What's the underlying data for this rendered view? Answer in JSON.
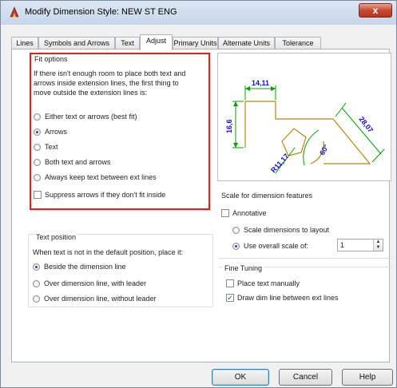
{
  "window": {
    "title": "Modify Dimension Style: NEW ST ENG",
    "close_label": "x"
  },
  "tabs": [
    {
      "label": "Lines",
      "active": false
    },
    {
      "label": "Symbols and Arrows",
      "active": false
    },
    {
      "label": "Text",
      "active": false
    },
    {
      "label": "Adjust",
      "active": true
    },
    {
      "label": "Primary Units",
      "active": false
    },
    {
      "label": "Alternate Units",
      "active": false
    },
    {
      "label": "Tolerance",
      "active": false
    }
  ],
  "fit_options": {
    "title": "Fit options",
    "description": [
      "If there isn't enough room to place both text and",
      "arrows inside extension lines, the first thing to",
      "move outside the extension lines is:"
    ],
    "options": [
      {
        "label": "Either text or arrows (best fit)",
        "selected": false
      },
      {
        "label": "Arrows",
        "selected": true
      },
      {
        "label": "Text",
        "selected": false
      },
      {
        "label": "Both text and arrows",
        "selected": false
      },
      {
        "label": "Always keep text between ext lines",
        "selected": false
      }
    ],
    "suppress_label": "Suppress arrows if they don't fit inside",
    "suppress_checked": false
  },
  "preview": {
    "dims": [
      "14,11",
      "16,6",
      "28,07",
      "R11,17",
      "60°"
    ],
    "line_color": "#b8860b",
    "dim_color": "#00a000",
    "text_color": "#1010c0"
  },
  "scale": {
    "title": "Scale for dimension features",
    "annotative_label": "Annotative",
    "annotative_checked": false,
    "options": [
      {
        "label": "Scale dimensions to layout",
        "selected": false
      },
      {
        "label": "Use overall scale of:",
        "selected": true
      }
    ],
    "overall_scale_value": "1"
  },
  "text_position": {
    "title": "Text position",
    "description": "When text is not in the default position, place it:",
    "options": [
      {
        "label": "Beside the dimension line",
        "selected": true
      },
      {
        "label": "Over dimension line, with leader",
        "selected": false
      },
      {
        "label": "Over dimension line, without leader",
        "selected": false
      }
    ]
  },
  "fine_tuning": {
    "title": "Fine Tuning",
    "options": [
      {
        "label": "Place text manually",
        "checked": false
      },
      {
        "label": "Draw dim line between ext lines",
        "checked": true
      }
    ]
  },
  "buttons": {
    "ok": "OK",
    "cancel": "Cancel",
    "help": "Help"
  }
}
